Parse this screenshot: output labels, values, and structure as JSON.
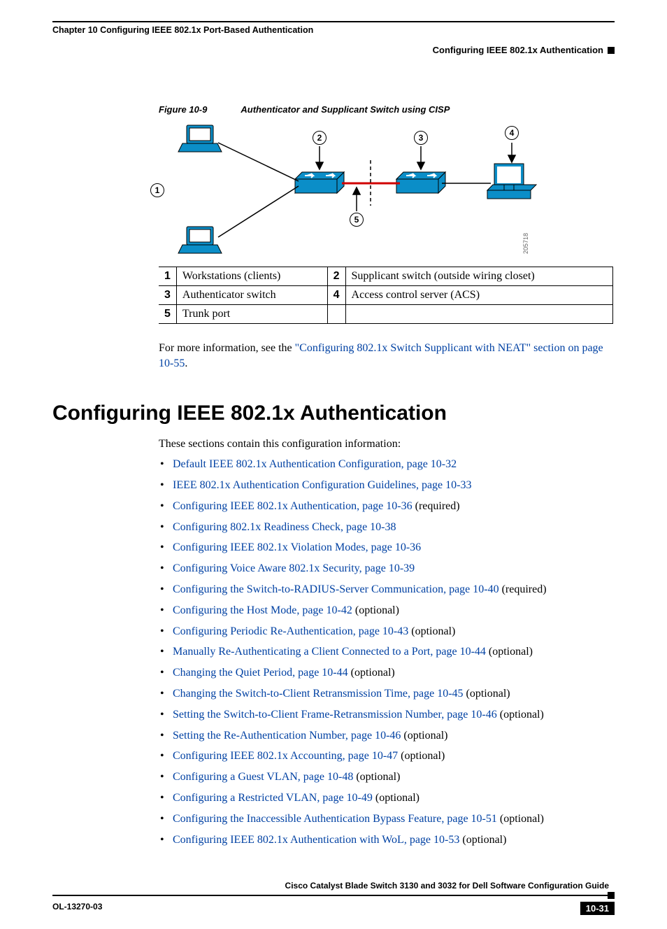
{
  "header": {
    "chapter": "Chapter 10    Configuring IEEE 802.1x Port-Based Authentication",
    "section": "Configuring IEEE 802.1x Authentication"
  },
  "figure": {
    "label": "Figure 10-9",
    "title": "Authenticator and Supplicant Switch using CISP",
    "markers": {
      "m1": "1",
      "m2": "2",
      "m3": "3",
      "m4": "4",
      "m5": "5"
    },
    "imgnum": "205718"
  },
  "legend": {
    "r1c1n": "1",
    "r1c1": "Workstations (clients)",
    "r1c2n": "2",
    "r1c2": "Supplicant switch (outside wiring closet)",
    "r2c1n": "3",
    "r2c1": "Authenticator switch",
    "r2c2n": "4",
    "r2c2": "Access control server (ACS)",
    "r3c1n": "5",
    "r3c1": "Trunk port",
    "r3c2n": "",
    "r3c2": ""
  },
  "para": {
    "pre": "For more information, see the ",
    "link": "\"Configuring 802.1x Switch Supplicant with NEAT\" section on page 10-55",
    "post": "."
  },
  "h1": "Configuring IEEE 802.1x Authentication",
  "intro": "These sections contain this configuration information:",
  "toc": [
    {
      "link": "Default IEEE 802.1x Authentication Configuration, page 10-32",
      "suffix": ""
    },
    {
      "link": "IEEE 802.1x Authentication Configuration Guidelines, page 10-33",
      "suffix": ""
    },
    {
      "link": "Configuring IEEE 802.1x Authentication, page 10-36",
      "suffix": " (required)"
    },
    {
      "link": "Configuring 802.1x Readiness Check, page 10-38",
      "suffix": ""
    },
    {
      "link": "Configuring IEEE 802.1x Violation Modes, page 10-36",
      "suffix": ""
    },
    {
      "link": "Configuring Voice Aware 802.1x Security, page 10-39",
      "suffix": ""
    },
    {
      "link": "Configuring the Switch-to-RADIUS-Server Communication, page 10-40",
      "suffix": " (required)"
    },
    {
      "link": "Configuring the Host Mode, page 10-42",
      "suffix": " (optional)"
    },
    {
      "link": "Configuring Periodic Re-Authentication, page 10-43",
      "suffix": " (optional)"
    },
    {
      "link": "Manually Re-Authenticating a Client Connected to a Port, page 10-44",
      "suffix": " (optional)"
    },
    {
      "link": "Changing the Quiet Period, page 10-44",
      "suffix": " (optional)"
    },
    {
      "link": "Changing the Switch-to-Client Retransmission Time, page 10-45",
      "suffix": " (optional)"
    },
    {
      "link": "Setting the Switch-to-Client Frame-Retransmission Number, page 10-46",
      "suffix": " (optional)"
    },
    {
      "link": "Setting the Re-Authentication Number, page 10-46",
      "suffix": " (optional)"
    },
    {
      "link": "Configuring IEEE 802.1x Accounting, page 10-47",
      "suffix": " (optional)"
    },
    {
      "link": "Configuring a Guest VLAN, page 10-48",
      "suffix": " (optional)"
    },
    {
      "link": "Configuring a Restricted VLAN, page 10-49",
      "suffix": " (optional)"
    },
    {
      "link": "Configuring the Inaccessible Authentication Bypass Feature, page 10-51",
      "suffix": " (optional)"
    },
    {
      "link": "Configuring IEEE 802.1x Authentication with WoL, page 10-53",
      "suffix": " (optional)"
    }
  ],
  "footer": {
    "title": "Cisco Catalyst Blade Switch 3130 and 3032 for Dell Software Configuration Guide",
    "docnum": "OL-13270-03",
    "page": "10-31"
  }
}
